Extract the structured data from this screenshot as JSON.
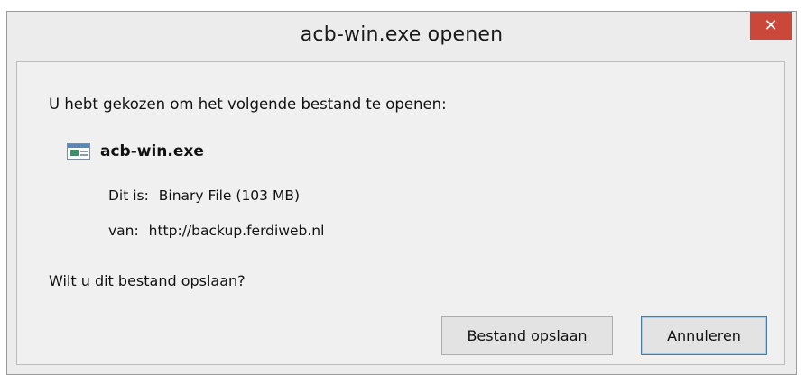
{
  "window": {
    "title": "acb-win.exe openen",
    "close_symbol": "✕"
  },
  "dialog": {
    "prompt": "U hebt gekozen om het volgende bestand te openen:",
    "file": {
      "icon": "application-window-icon",
      "name": "acb-win.exe"
    },
    "type_label": "Dit is:",
    "type_value": "Binary File (103 MB)",
    "from_label": "van:",
    "from_value": "http://backup.ferdiweb.nl",
    "question": "Wilt u dit bestand opslaan?"
  },
  "buttons": {
    "save_label": "Bestand opslaan",
    "cancel_label": "Annuleren"
  },
  "colors": {
    "close_button": "#c9483a",
    "focus_border": "#3c7fb1"
  }
}
